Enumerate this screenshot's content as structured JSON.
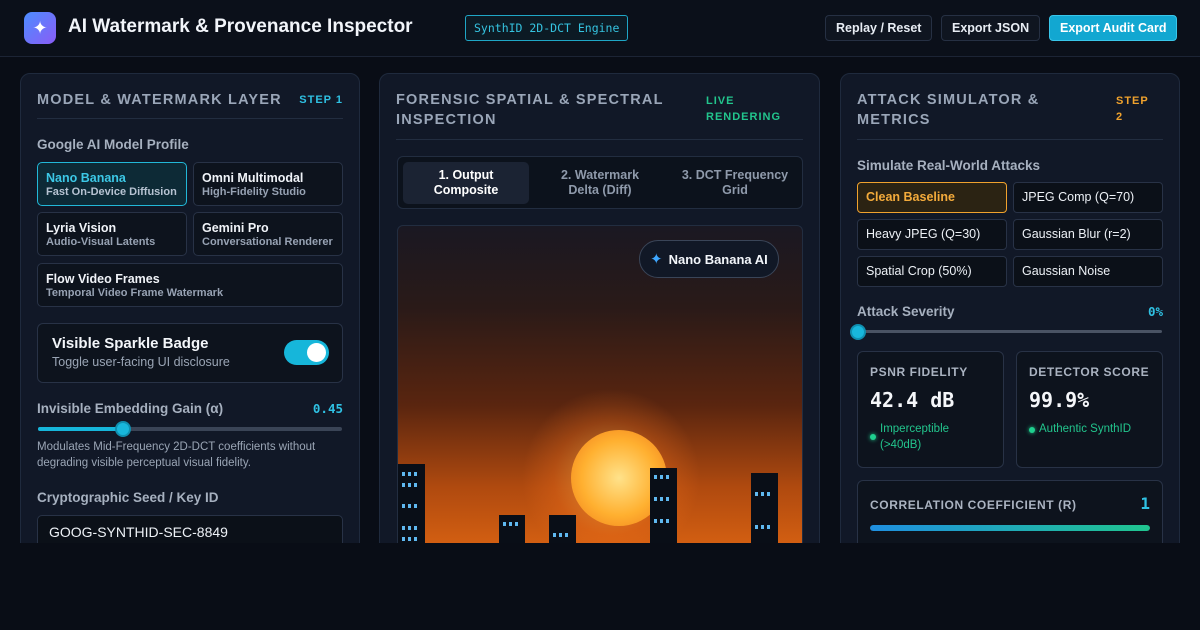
{
  "header": {
    "logo_icon": "✦",
    "title": "AI Watermark & Provenance Inspector",
    "engine_badge": "SynthID 2D-DCT Engine",
    "buttons": {
      "replay": "Replay / Reset",
      "export_json": "Export JSON",
      "export_card": "Export Audit Card"
    }
  },
  "panel1": {
    "title": "MODEL & WATERMARK LAYER",
    "step": "STEP 1",
    "model_profile_label": "Google AI Model Profile",
    "models": [
      {
        "name": "Nano Banana",
        "desc": "Fast On-Device Diffusion",
        "active": true
      },
      {
        "name": "Omni Multimodal",
        "desc": "High-Fidelity Studio",
        "active": false
      },
      {
        "name": "Lyria Vision",
        "desc": "Audio-Visual Latents",
        "active": false
      },
      {
        "name": "Gemini Pro",
        "desc": "Conversational Renderer",
        "active": false
      },
      {
        "name": "Flow Video Frames",
        "desc": "Temporal Video Frame Watermark",
        "active": false
      }
    ],
    "badge_toggle": {
      "title": "Visible Sparkle Badge",
      "desc": "Toggle user-facing UI disclosure",
      "on": true
    },
    "gain": {
      "label": "Invisible Embedding Gain (α)",
      "value": "0.45",
      "fraction": 0.28,
      "help": "Modulates Mid-Frequency 2D-DCT coefficients without degrading visible perceptual visual fidelity."
    },
    "seed": {
      "label": "Cryptographic Seed / Key ID",
      "value": "GOOG-SYNTHID-SEC-8849"
    }
  },
  "panel2": {
    "title_line1": "FORENSIC SPATIAL & SPECTRAL",
    "title_line2": "INSPECTION",
    "status_line1": "LIVE",
    "status_line2": "RENDERING",
    "tabs": [
      {
        "line1": "1. Output",
        "line2": "Composite",
        "active": true
      },
      {
        "line1": "2. Watermark",
        "line2": "Delta (Diff)",
        "active": false
      },
      {
        "line1": "3. DCT Frequency",
        "line2": "Grid",
        "active": false
      }
    ],
    "chip": {
      "icon": "✦",
      "label": "Nano Banana AI"
    }
  },
  "panel3": {
    "title_line1": "ATTACK SIMULATOR &",
    "title_line2": "METRICS",
    "step_line1": "STEP",
    "step_line2": "2",
    "attacks_label": "Simulate Real-World Attacks",
    "attacks": [
      {
        "label": "Clean Baseline",
        "active": true
      },
      {
        "label": "JPEG Comp (Q=70)",
        "active": false
      },
      {
        "label": "Heavy JPEG (Q=30)",
        "active": false
      },
      {
        "label": "Gaussian Blur (r=2)",
        "active": false
      },
      {
        "label": "Spatial Crop (50%)",
        "active": false
      },
      {
        "label": "Gaussian Noise",
        "active": false
      }
    ],
    "severity": {
      "label": "Attack Severity",
      "value": "0%",
      "fraction": 0
    },
    "psnr": {
      "title": "PSNR FIDELITY",
      "value": "42.4 dB",
      "status_line1": "Imperceptible",
      "status_line2": "(>40dB)"
    },
    "detector": {
      "title": "DETECTOR SCORE",
      "value": "99.9%",
      "status": "Authentic SynthID"
    },
    "correlation": {
      "title": "CORRELATION COEFFICIENT (R)",
      "value": "1",
      "fraction": 1.0
    }
  },
  "colors": {
    "accent": "#16b6da",
    "step1": "#2fc1e3",
    "live": "#22c58d",
    "step2": "#f0a22d",
    "active_attack": "#f4ab3b"
  }
}
